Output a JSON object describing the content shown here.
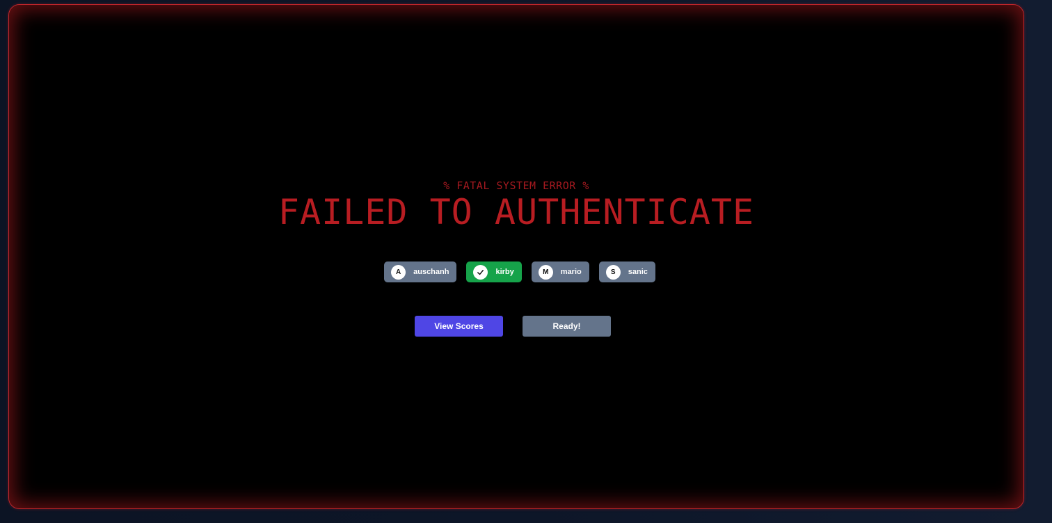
{
  "error": {
    "subtitle": "% FATAL SYSTEM ERROR %",
    "headline": "FAILED TO AUTHENTICATE"
  },
  "players": [
    {
      "initial": "A",
      "name": "auschanh",
      "ready": false
    },
    {
      "initial": "",
      "name": "kirby",
      "ready": true
    },
    {
      "initial": "M",
      "name": "mario",
      "ready": false
    },
    {
      "initial": "S",
      "name": "sanic",
      "ready": false
    }
  ],
  "actions": {
    "view_scores_label": "View Scores",
    "ready_label": "Ready!"
  },
  "colors": {
    "error_red": "#b81d22",
    "frame_border": "#c0262b",
    "chip_default": "#64748b",
    "chip_ready": "#16a34a",
    "primary_button": "#4f46e5",
    "secondary_button": "#64748b"
  }
}
